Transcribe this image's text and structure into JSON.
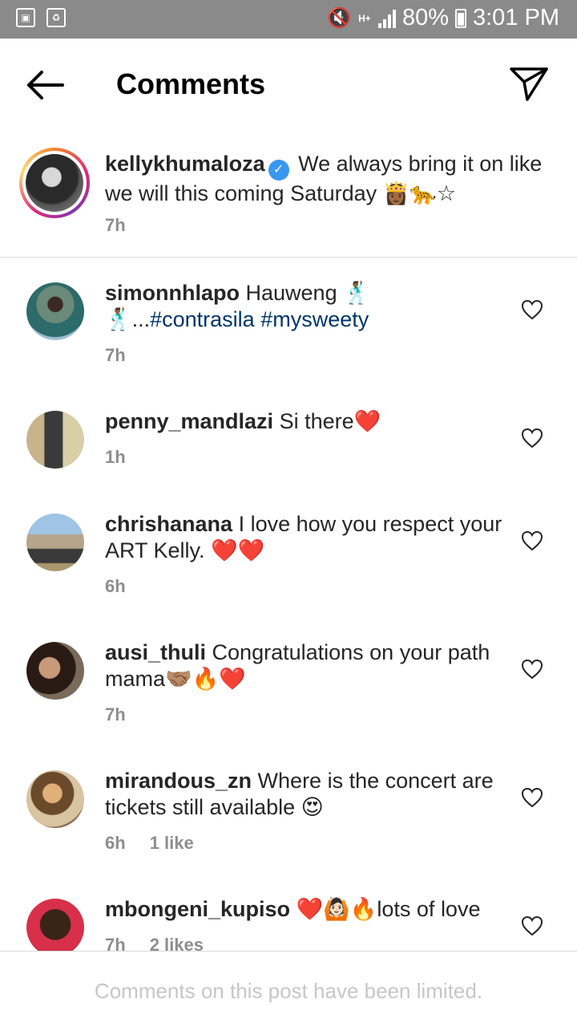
{
  "status_bar": {
    "battery": "80%",
    "time": "3:01 PM",
    "network": "H+",
    "icons": [
      "gallery-icon",
      "recycle-icon",
      "mute-icon",
      "signal-icon",
      "battery-icon"
    ]
  },
  "header": {
    "title": "Comments",
    "back_icon": "arrow-left-icon",
    "share_icon": "paper-plane-icon"
  },
  "caption": {
    "username": "kellykhumaloza",
    "verified": true,
    "text": "We always bring it on like we will this coming Saturday",
    "emojis": "👸🏾🐆☆",
    "time": "7h"
  },
  "comments": [
    {
      "username": "simonnhlapo",
      "text": "Hauweng 🕺🏾",
      "text2": "🕺🏾...",
      "hashtags": "#contrasila #mysweety",
      "time": "7h",
      "likes": ""
    },
    {
      "username": "penny_mandlazi",
      "text": "Si there❤️",
      "time": "1h",
      "likes": ""
    },
    {
      "username": "chrishanana",
      "text": "I love how you respect your ART Kelly. ❤️❤️",
      "time": "6h",
      "likes": ""
    },
    {
      "username": "ausi_thuli",
      "text": "Congratulations on your path mama🤝🏽🔥❤️",
      "time": "7h",
      "likes": ""
    },
    {
      "username": "mirandous_zn",
      "text": "Where is the concert are tickets still available 😍",
      "time": "6h",
      "likes": "1 like"
    },
    {
      "username": "mbongeni_kupiso",
      "text": "❤️🙆🏻🔥lots of love",
      "time": "7h",
      "likes": "2 likes"
    }
  ],
  "footer": {
    "text": "Comments on this post have been limited."
  },
  "colors": {
    "status_bar": "#8a8a8a",
    "hashtag": "#003569",
    "meta": "#8e8e8e",
    "verified": "#3897f0",
    "footer_text": "#c7c7c7"
  }
}
